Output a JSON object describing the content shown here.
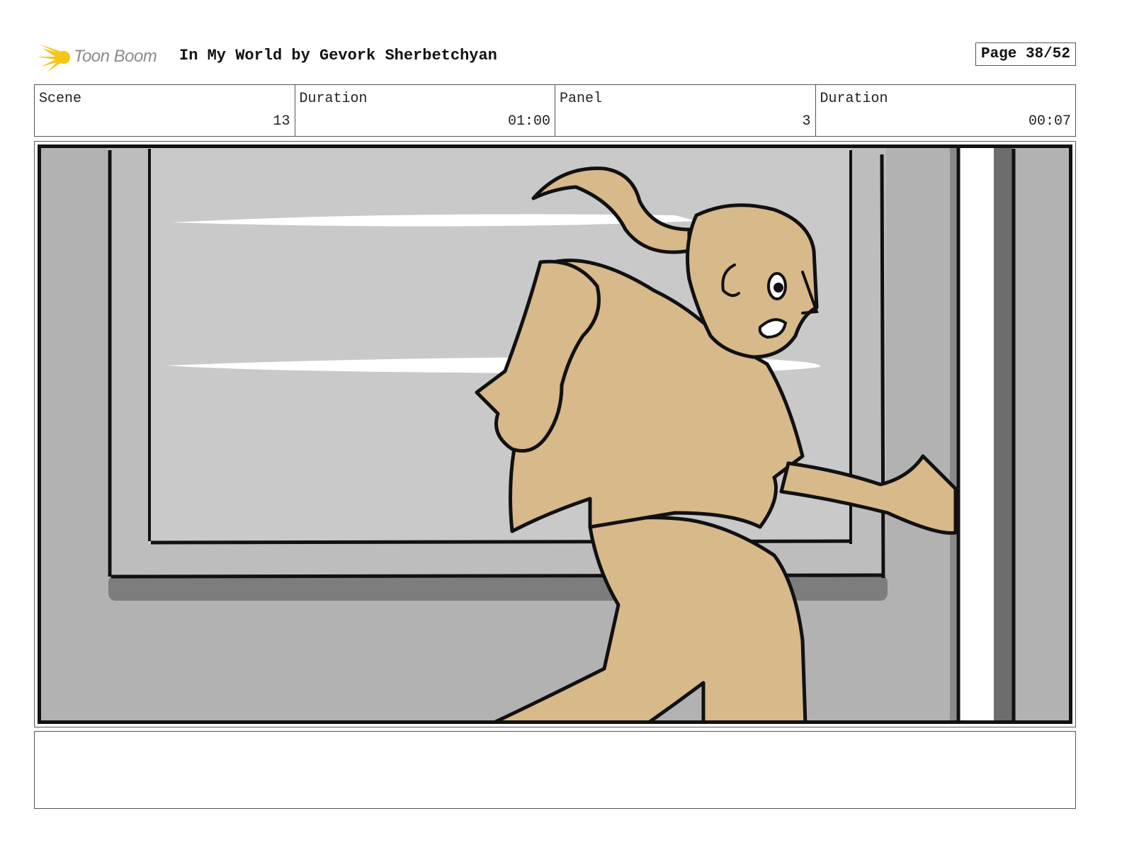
{
  "header": {
    "logo_text": "Toon Boom",
    "title": "In My World by Gevork Sherbetchyan",
    "page_label": "Page 38/52"
  },
  "info": {
    "scene_label": "Scene",
    "scene_value": "13",
    "scene_duration_label": "Duration",
    "scene_duration_value": "01:00",
    "panel_label": "Panel",
    "panel_value": "3",
    "panel_duration_label": "Duration",
    "panel_duration_value": "00:07"
  },
  "colors": {
    "skin": "#d8b98a",
    "wall": "#b2b2b2",
    "window_glass": "#c9c9c9",
    "shadow": "#7d7d7d",
    "logo_star": "#f5c518"
  },
  "notes": {
    "text": ""
  }
}
